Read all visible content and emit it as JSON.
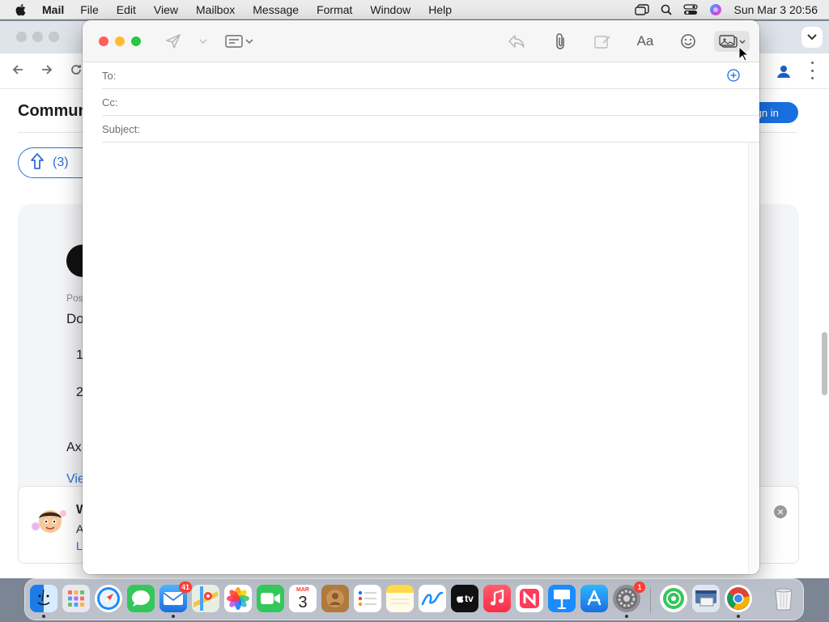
{
  "menubar": {
    "app_name": "Mail",
    "items": [
      "File",
      "Edit",
      "View",
      "Mailbox",
      "Message",
      "Format",
      "Window",
      "Help"
    ],
    "clock": "Sun Mar 3  20:56"
  },
  "browser": {
    "page_title": "Commun",
    "signin_label": "Sign in",
    "vote_count": "(3)",
    "posted_fragment": "Pos",
    "text_fragment_1": "Do",
    "text_fragment_2": "1",
    "text_fragment_3": "2",
    "text_fragment_4": "Ax",
    "link_fragment": "Vie",
    "promo_title_fragment": "W",
    "promo_text_fragment": "A",
    "promo_link_fragment": "L"
  },
  "compose": {
    "to_label": "To:",
    "cc_label": "Cc:",
    "subject_label": "Subject:",
    "to_value": "",
    "cc_value": "",
    "subject_value": "",
    "font_button_label": "Aa"
  },
  "dock": {
    "mail_badge": "41",
    "calendar_month": "MAR",
    "calendar_day": "3",
    "settings_badge": "1",
    "tv_label": "tv"
  },
  "colors": {
    "close": "#ff5f57",
    "minimize": "#febc2e",
    "zoom": "#28c840",
    "accent": "#1a6fe0"
  }
}
